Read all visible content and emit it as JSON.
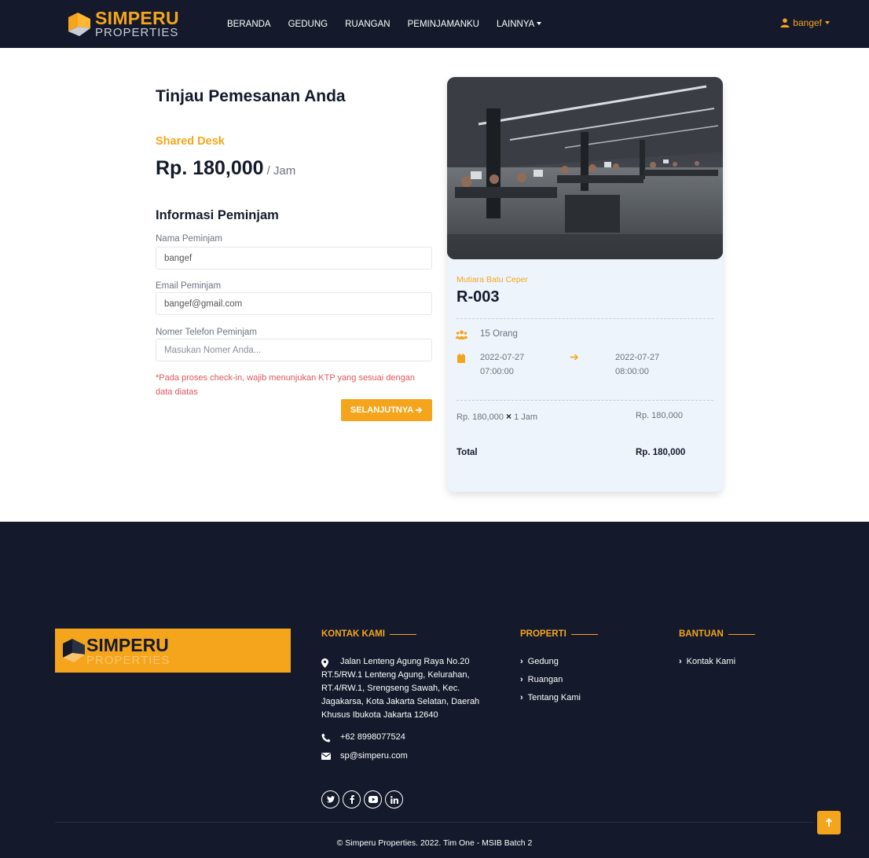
{
  "brand": {
    "title": "SIMPERU",
    "subtitle": "PROPERTIES"
  },
  "nav": {
    "links": [
      "BERANDA",
      "GEDUNG",
      "RUANGAN",
      "PEMINJAMANKU",
      "LAINNYA"
    ],
    "user": "bangef"
  },
  "booking": {
    "page_title": "Tinjau Pemesanan Anda",
    "room_type": "Shared Desk",
    "price": "Rp. 180,000",
    "price_unit": "/ Jam",
    "section_title": "Informasi Peminjam",
    "name_label": "Nama Peminjam",
    "name_value": "bangef",
    "email_label": "Email Peminjam",
    "email_value": "bangef@gmail.com",
    "phone_label": "Nomer Telefon Peminjam",
    "phone_placeholder": "Masukan Nomer Anda...",
    "notice": "*Pada proses check-in, wajib menunjukan KTP yang sesuai dengan data diatas",
    "next_button": "SELANJUTNYA"
  },
  "summary": {
    "location": "Mutiara Batu Ceper",
    "room_code": "R-003",
    "capacity": "15 Orang",
    "start_date": "2022-07-27",
    "start_time": "07:00:00",
    "end_date": "2022-07-27",
    "end_time": "08:00:00",
    "calc_price": "Rp. 180,000",
    "calc_mult": "×",
    "calc_duration": "1 Jam",
    "calc_subtotal": "Rp. 180,000",
    "total_label": "Total",
    "total_value": "Rp. 180,000"
  },
  "footer": {
    "contact_heading": "KONTAK KAMI",
    "address": "Jalan Lenteng Agung Raya No.20 RT.5/RW.1 Lenteng Agung, Kelurahan, RT.4/RW.1, Srengseng Sawah, Kec. Jagakarsa, Kota Jakarta Selatan, Daerah Khusus Ibukota Jakarta 12640",
    "phone": "+62 8998077524",
    "email": "sp@simperu.com",
    "property_heading": "PROPERTI",
    "property_links": [
      "Gedung",
      "Ruangan",
      "Tentang Kami"
    ],
    "help_heading": "BANTUAN",
    "help_links": [
      "Kontak Kami"
    ],
    "copyright": "© Simperu Properties. 2022. Tim One - MSIB Batch 2"
  },
  "colors": {
    "accent": "#f5a51c",
    "navy": "#141a2b",
    "card_bg": "#eef4fb",
    "notice": "#e0555e"
  },
  "icons": [
    "user-icon",
    "group-icon",
    "calendar-icon",
    "arrow-right-icon",
    "map-marker-icon",
    "phone-icon",
    "envelope-icon",
    "twitter-icon",
    "facebook-icon",
    "youtube-icon",
    "linkedin-icon",
    "arrow-up-icon"
  ]
}
